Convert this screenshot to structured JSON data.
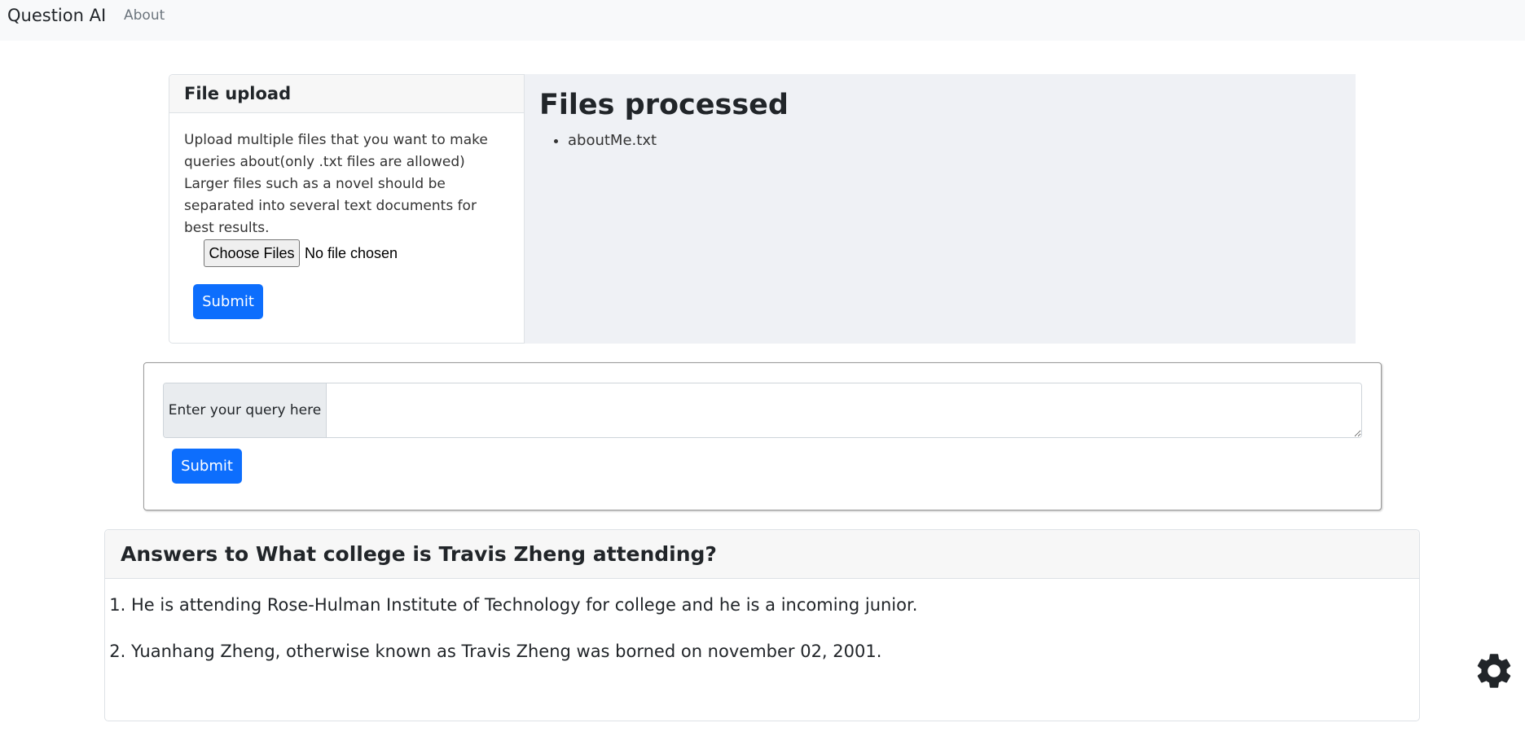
{
  "nav": {
    "brand": "Question AI",
    "about": "About"
  },
  "upload": {
    "title": "File upload",
    "description": "Upload multiple files that you want to make queries about(only .txt files are allowed) Larger files such as a novel should be separated into several text documents for best results.",
    "choose_label": "Choose Files",
    "file_status": "No file chosen",
    "submit_label": "Submit"
  },
  "processed": {
    "title": "Files processed",
    "files": [
      "aboutMe.txt"
    ]
  },
  "query": {
    "label": "Enter your query here",
    "value": "",
    "submit_label": "Submit"
  },
  "answers": {
    "title": "Answers to What college is Travis Zheng attending?",
    "items": [
      "He is attending Rose-Hulman Institute of Technology for college and he is a incoming junior.",
      "Yuanhang Zheng, otherwise known as Travis Zheng was borned on november 02, 2001."
    ]
  },
  "settings": {
    "icon": "gear-icon"
  },
  "colors": {
    "primary": "#0d6efd",
    "navbar_bg": "#f8f9fa",
    "panel_bg": "#eff1f5"
  }
}
